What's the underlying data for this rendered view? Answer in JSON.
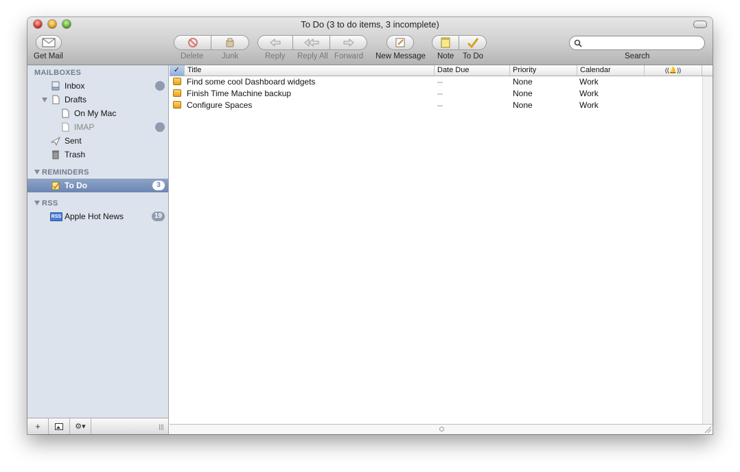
{
  "window": {
    "title": "To Do (3 to do items, 3 incomplete)"
  },
  "toolbar": {
    "get_mail": "Get Mail",
    "delete": "Delete",
    "junk": "Junk",
    "reply": "Reply",
    "reply_all": "Reply All",
    "forward": "Forward",
    "new_message": "New Message",
    "note": "Note",
    "todo": "To Do",
    "search_label": "Search",
    "search_value": ""
  },
  "sidebar": {
    "mailboxes": {
      "header": "MAILBOXES",
      "inbox": "Inbox",
      "drafts": "Drafts",
      "on_my_mac": "On My Mac",
      "imap": "IMAP",
      "sent": "Sent",
      "trash": "Trash"
    },
    "reminders": {
      "header": "REMINDERS",
      "todo": "To Do",
      "todo_count": "3"
    },
    "rss": {
      "header": "RSS",
      "apple_hot_news": "Apple Hot News",
      "apple_hot_news_count": "19",
      "rss_icon_text": "RSS"
    },
    "bottom": {
      "add": "+",
      "gear": "⚙▾",
      "grip": "|||"
    }
  },
  "table": {
    "columns": {
      "check": "✓",
      "title": "Title",
      "date_due": "Date Due",
      "priority": "Priority",
      "calendar": "Calendar",
      "alarm": "((🔔))"
    },
    "rows": [
      {
        "title": "Find some cool Dashboard widgets",
        "date_due": "--",
        "priority": "None",
        "calendar": "Work"
      },
      {
        "title": "Finish Time Machine backup",
        "date_due": "--",
        "priority": "None",
        "calendar": "Work"
      },
      {
        "title": "Configure Spaces",
        "date_due": "--",
        "priority": "None",
        "calendar": "Work"
      }
    ]
  },
  "colors": {
    "sidebar_bg": "#dde3ec",
    "selection": "#7a92bd",
    "badge": "#8e9bb0",
    "todo_box": "#e8a113"
  }
}
